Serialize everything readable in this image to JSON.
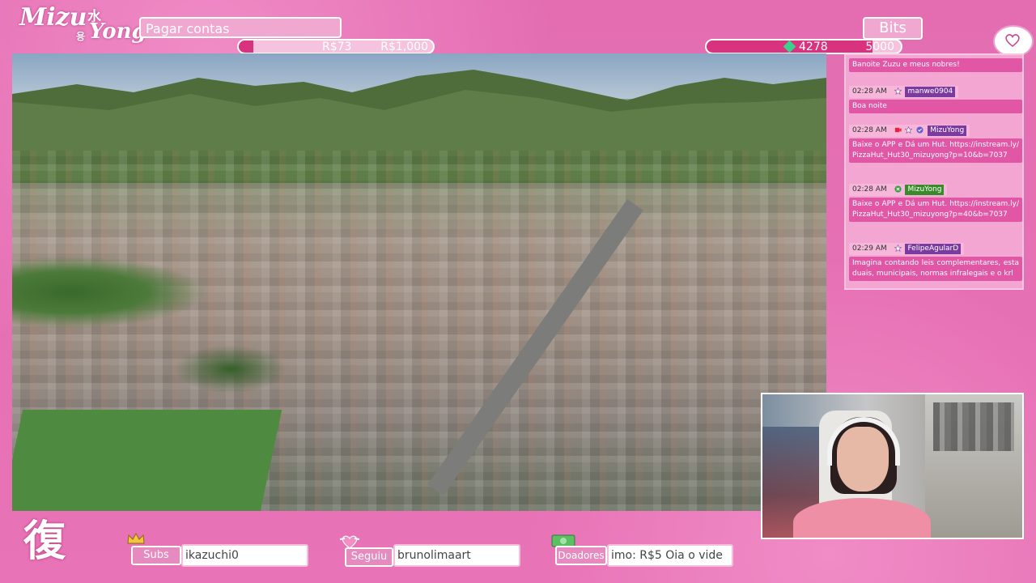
{
  "brand": {
    "line1": "Mizu",
    "line2": "Yong",
    "kanji": "水",
    "kanji_small": "용"
  },
  "goal": {
    "title": "Pagar contas",
    "current": "R$73",
    "max": "R$1,000",
    "progress": 0.073
  },
  "bits": {
    "label": "Bits",
    "current": "4278",
    "max": "5000",
    "progress": 0.8556
  },
  "chat": {
    "messages": [
      {
        "time": "",
        "user": "",
        "text": "Banoite Zuzu e meus nobres!"
      },
      {
        "time": "02:28 AM",
        "user": "manwe0904",
        "badges": [
          "star"
        ],
        "text": "Boa noite"
      },
      {
        "time": "02:28 AM",
        "user": "MizuYong",
        "badges": [
          "broadcaster",
          "star",
          "verified"
        ],
        "text": "Baixe o APP e Dá um Hut. https://instream.ly/PizzaHut_Hut30_mizuyong?p=10&b=7037"
      },
      {
        "time": "02:28 AM",
        "user": "MizuYong",
        "badges": [
          "bot"
        ],
        "text": "Baixe o APP e Dá um Hut. https://instream.ly/PizzaHut_Hut30_mizuyong?p=40&b=7037"
      },
      {
        "time": "02:29 AM",
        "user": "FelipeAgularD",
        "badges": [
          "star"
        ],
        "text": "Imagina contando leis complementares, estaduais, municipais, normas infralegais e o krl"
      }
    ]
  },
  "footer": {
    "logo": "復",
    "subs_label": "Subs",
    "subs_value": "ikazuchi0",
    "follow_label": "Seguiu",
    "follow_value": "brunolimaart",
    "donors_label": "Doadores",
    "donors_value": "imo: R$5    Oia o vide"
  },
  "colors": {
    "frame": "#e86ab3",
    "accent": "#d9327e",
    "chat_body": "#e157a6"
  }
}
